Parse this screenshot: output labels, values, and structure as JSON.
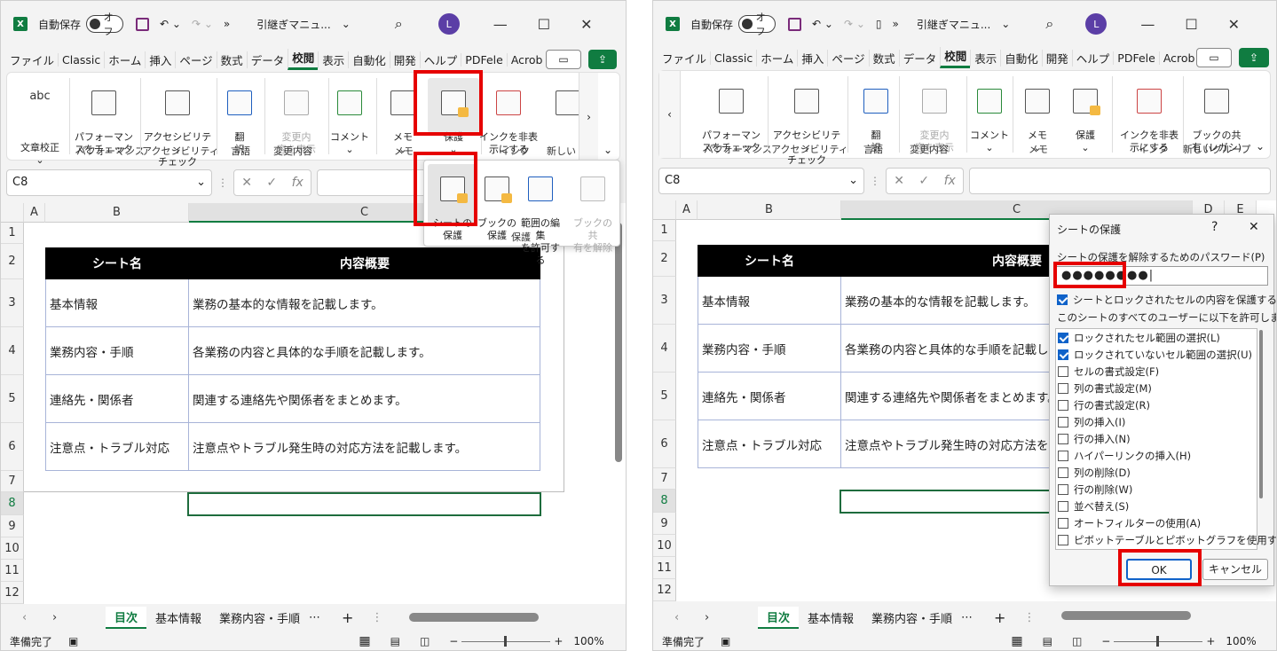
{
  "title_bar": {
    "autosave_label": "自動保存",
    "toggle_label": "オフ",
    "filename": "引継ぎマニュ..."
  },
  "avatar": "L",
  "tabs": [
    "ファイル",
    "Classic",
    "ホーム",
    "挿入",
    "ページ",
    "数式",
    "データ",
    "校閲",
    "表示",
    "自動化",
    "開発",
    "ヘルプ",
    "PDFele",
    "Acrob"
  ],
  "active_tab": "校閲",
  "ribbon": {
    "spell": "文章校正",
    "spell_icon_text": "abc",
    "performance": "パフォーマン\nスをチェック",
    "performance_group": "パフォーマンス",
    "accessibility": "アクセシビリティ\nチェック",
    "accessibility_group": "アクセシビリティ",
    "translate": "翻\n訳",
    "language_group": "言語",
    "changes": "変更内\n容を表示",
    "changes_group": "変更内容",
    "comment": "コメント",
    "memo": "メモ",
    "memo_group": "メモ",
    "protect": "保護",
    "ink": "インクを非表\n示にする",
    "ink_group": "インク",
    "book_share": "ブックの共\n有 (レガシ)",
    "new_group": "新しいグループ",
    "new_group_short": "新しい"
  },
  "protect_popup": {
    "sheet": "シートの\n保護",
    "book": "ブックの\n保護",
    "range": "範囲の編集\nを許可する",
    "unshare": "ブックの共\n有を解除",
    "group": "保護"
  },
  "namebox": "C8",
  "fx": "fx",
  "columns": [
    "A",
    "B",
    "C",
    "D",
    "E"
  ],
  "rows": [
    "1",
    "2",
    "3",
    "4",
    "5",
    "6",
    "7",
    "8",
    "9",
    "10",
    "11",
    "12"
  ],
  "table": {
    "header": [
      "シート名",
      "内容概要"
    ],
    "body": [
      [
        "基本情報",
        "業務の基本的な情報を記載します。"
      ],
      [
        "業務内容・手順",
        "各業務の内容と具体的な手順を記載します。"
      ],
      [
        "連絡先・関係者",
        "関連する連絡先や関係者をまとめます。"
      ],
      [
        "注意点・トラブル対応",
        "注意点やトラブル発生時の対応方法を記載します。"
      ]
    ]
  },
  "sheet_tabs": [
    "目次",
    "基本情報",
    "業務内容・手順"
  ],
  "status": {
    "ready": "準備完了",
    "zoom": "100%"
  },
  "dialog": {
    "title": "シートの保護",
    "help": "?",
    "close": "✕",
    "pwd_label": "シートの保護を解除するためのパスワード(P)",
    "pwd_value": "●●●●●●●●|",
    "protect_cb": "シートとロックされたセルの内容を保護する(C)",
    "allow_label": "このシートのすべてのユーザーに以下を許可します。",
    "perms": [
      {
        "label": "ロックされたセル範囲の選択(L)",
        "checked": true
      },
      {
        "label": "ロックされていないセル範囲の選択(U)",
        "checked": true
      },
      {
        "label": "セルの書式設定(F)",
        "checked": false
      },
      {
        "label": "列の書式設定(M)",
        "checked": false
      },
      {
        "label": "行の書式設定(R)",
        "checked": false
      },
      {
        "label": "列の挿入(I)",
        "checked": false
      },
      {
        "label": "行の挿入(N)",
        "checked": false
      },
      {
        "label": "ハイパーリンクの挿入(H)",
        "checked": false
      },
      {
        "label": "列の削除(D)",
        "checked": false
      },
      {
        "label": "行の削除(W)",
        "checked": false
      },
      {
        "label": "並べ替え(S)",
        "checked": false
      },
      {
        "label": "オートフィルターの使用(A)",
        "checked": false
      },
      {
        "label": "ピボットテーブルとピボットグラフを使用する",
        "checked": false
      }
    ],
    "ok": "OK",
    "cancel": "キャンセル"
  },
  "highlight_color": "#e60000",
  "accent": "#107c41"
}
